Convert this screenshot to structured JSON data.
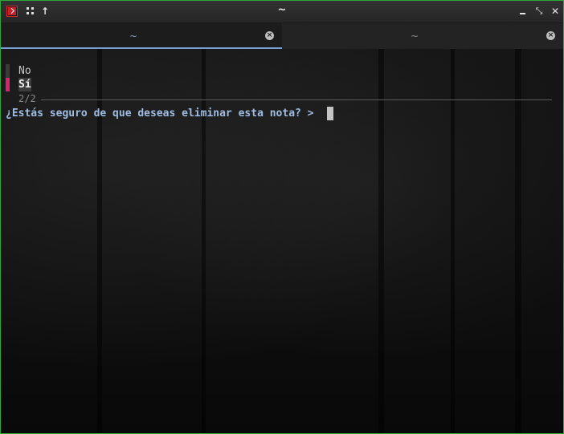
{
  "window": {
    "title": "~",
    "buttons": {
      "maximize": "⤡",
      "close": "✕"
    }
  },
  "toolbar_icons": [
    "terminal-app-icon",
    "grid-icon",
    "arrow-up-icon"
  ],
  "tabs": [
    {
      "label": "~",
      "active": true
    },
    {
      "label": "~",
      "active": false
    }
  ],
  "terminal": {
    "options": [
      {
        "label": "No",
        "selected": false
      },
      {
        "label": "Sí",
        "selected": true
      }
    ],
    "counter": "2/2",
    "prompt": "¿Estás seguro de que deseas eliminar esta nota? >"
  },
  "colors": {
    "border": "#2fa83a",
    "accent_tab": "#7aa0d6",
    "selected_marker": "#d6246e",
    "prompt_text": "#9fbde4"
  }
}
